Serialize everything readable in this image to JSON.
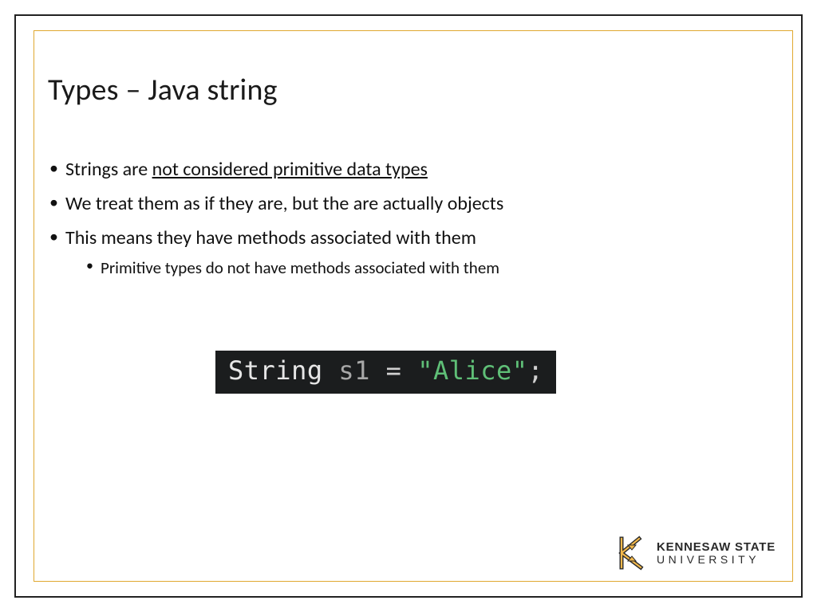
{
  "title": "Types – Java string",
  "bullets": [
    {
      "pre": "Strings are ",
      "underlined": "not considered primitive data types",
      "post": ""
    },
    {
      "pre": "We treat them as if they are, but the are actually objects",
      "underlined": "",
      "post": ""
    },
    {
      "pre": "This means they have methods associated with them",
      "underlined": "",
      "post": "",
      "sub": [
        "Primitive types do not have methods associated with them"
      ]
    }
  ],
  "code": {
    "type": "String",
    "var": "s1",
    "op": "=",
    "string": "\"Alice\"",
    "semi": ";"
  },
  "logo": {
    "line1": "KENNESAW STATE",
    "line2": "UNIVERSITY"
  }
}
